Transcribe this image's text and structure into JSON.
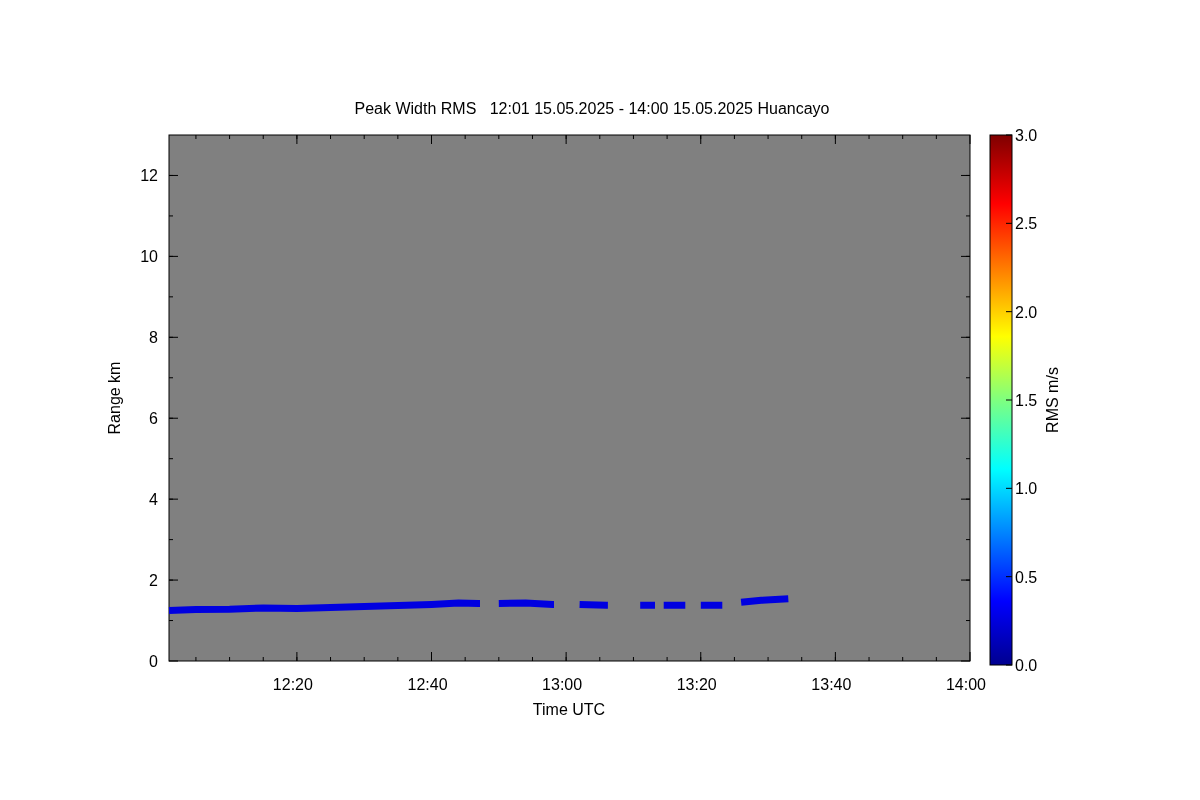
{
  "plot": {
    "title": "Peak Width RMS   12:01 15.05.2025 - 14:00 15.05.2025 Huancayo",
    "chart_data": {
      "type": "line",
      "xlabel": "Time UTC",
      "ylabel": "Range km",
      "xlim": [
        721,
        840
      ],
      "ylim": [
        0,
        13
      ],
      "xticks": [
        {
          "value": 740,
          "label": "12:20"
        },
        {
          "value": 760,
          "label": "12:40"
        },
        {
          "value": 780,
          "label": "13:00"
        },
        {
          "value": 800,
          "label": "13:20"
        },
        {
          "value": 820,
          "label": "13:40"
        },
        {
          "value": 840,
          "label": "14:00"
        }
      ],
      "yticks": [
        0,
        2,
        4,
        6,
        8,
        10,
        12
      ],
      "x": [
        721,
        725,
        730,
        735,
        740,
        745,
        750,
        755,
        760,
        764,
        767,
        767.2,
        770,
        774,
        778,
        778.2,
        782,
        786,
        786.2,
        791,
        793,
        793.2,
        794.5,
        797.5,
        797.7,
        800,
        803,
        803.2,
        806,
        809,
        813
      ],
      "series": [
        {
          "color": "#0000e0",
          "values": [
            1.25,
            1.27,
            1.28,
            1.31,
            1.3,
            1.32,
            1.35,
            1.37,
            1.4,
            1.43,
            1.42,
            null,
            1.42,
            1.43,
            1.4,
            null,
            1.4,
            1.38,
            null,
            1.38,
            1.38,
            null,
            1.38,
            1.38,
            null,
            1.38,
            1.38,
            null,
            1.45,
            1.5,
            1.54
          ]
        }
      ]
    }
  },
  "colorbar": {
    "label": "RMS m/s",
    "ticks": [
      "3.0",
      "2.5",
      "2.0",
      "1.5",
      "1.0",
      "0.5",
      "0.0"
    ]
  }
}
